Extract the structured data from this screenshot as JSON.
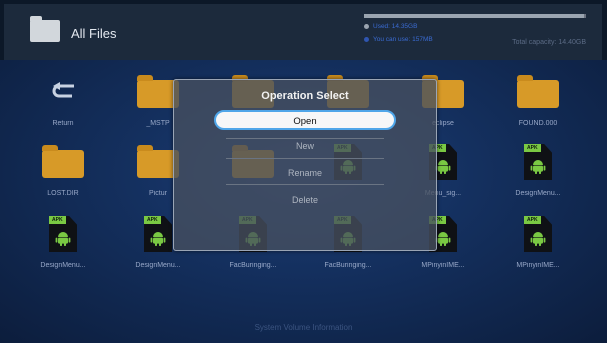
{
  "app": {
    "title": "All Files",
    "folder_icon": "folder-icon"
  },
  "storage": {
    "used_text": "Used: 14.35GB",
    "can_use_text": "You can use: 157MB",
    "total_capacity": "Total capacity: 14.40GB",
    "used_fraction": 0.99,
    "used_color": "#9aa4b0",
    "free_color": "#6b7280",
    "used_dot_color": "#9aa4b0",
    "free_dot_color": "#2f55b0"
  },
  "files": [
    {
      "name": "Return",
      "icon": "return-icon"
    },
    {
      "name": "_MSTP",
      "icon": "folder-icon"
    },
    {
      "name": "",
      "icon": "folder-icon"
    },
    {
      "name": "",
      "icon": "folder-icon"
    },
    {
      "name": "eclipse",
      "icon": "folder-icon"
    },
    {
      "name": "FOUND.000",
      "icon": "folder-icon"
    },
    {
      "name": "LOST.DIR",
      "icon": "folder-icon"
    },
    {
      "name": "Pictur",
      "icon": "folder-icon"
    },
    {
      "name": "",
      "icon": "folder-icon"
    },
    {
      "name": "",
      "icon": "apk-icon"
    },
    {
      "name": "Menu_sig...",
      "icon": "apk-icon"
    },
    {
      "name": "DesignMenu...",
      "icon": "apk-icon"
    },
    {
      "name": "DesignMenu...",
      "icon": "apk-icon"
    },
    {
      "name": "DesignMenu...",
      "icon": "apk-icon"
    },
    {
      "name": "FacBuringing...",
      "icon": "apk-icon"
    },
    {
      "name": "FacBuringing...",
      "icon": "apk-icon"
    },
    {
      "name": "MPinyinIME...",
      "icon": "apk-icon"
    },
    {
      "name": "MPinyinIME...",
      "icon": "apk-icon"
    }
  ],
  "bottom_item": "System Volume Information",
  "dialog": {
    "title": "Operation Select",
    "options": [
      "Open",
      "New",
      "Rename",
      "Delete"
    ],
    "selected": "Open",
    "accent": "#4fa6e9"
  }
}
